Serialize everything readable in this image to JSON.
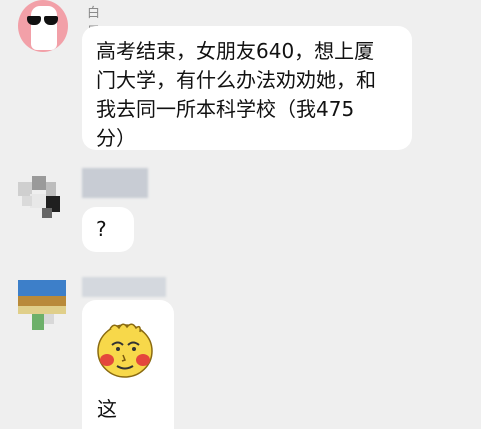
{
  "messages": [
    {
      "sender": "白果",
      "text_lines": [
        "高考结束，女朋友640，想上厦",
        "门大学，有什么办法劝劝她，和",
        "我去同一所本科学校（我475",
        "分）"
      ]
    },
    {
      "sender": "",
      "text": "?"
    },
    {
      "sender": "",
      "sticker": "blushing-yellow-face-sticker",
      "text": "这"
    }
  ],
  "colors": {
    "background": "#efefef",
    "bubble": "#ffffff",
    "sender_name": "#8a8a8a",
    "avatar1": "#f2a0a8"
  }
}
